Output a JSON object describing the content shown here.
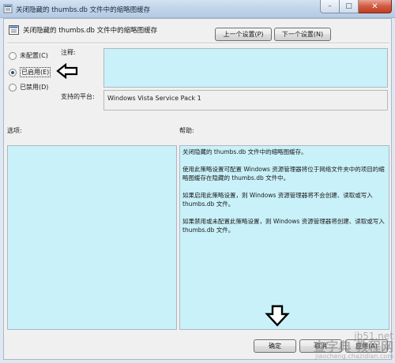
{
  "window": {
    "title": "关闭隐藏的 thumbs.db 文件中的缩略图缓存",
    "minimize_glyph": "–",
    "maximize_glyph": "□",
    "close_glyph": "✕"
  },
  "header": {
    "title": "关闭隐藏的 thumbs.db 文件中的缩略图缓存",
    "prev_button": "上一个设置(P)",
    "next_button": "下一个设置(N)"
  },
  "state": {
    "options": [
      {
        "label": "未配置(C)",
        "checked": false
      },
      {
        "label": "已启用(E)",
        "checked": true
      },
      {
        "label": "已禁用(D)",
        "checked": false
      }
    ]
  },
  "comment": {
    "label": "注释:",
    "value": ""
  },
  "platform": {
    "label": "支持的平台:",
    "value": "Windows Vista Service Pack 1"
  },
  "options_pane": {
    "label": "选项:"
  },
  "help_pane": {
    "label": "帮助:",
    "paragraphs": [
      "关闭隐藏的 thumbs.db 文件中的缩略图缓存。",
      "使用此策略设置可配置 Windows 资源管理器将位于网络文件夹中的项目的缩略图缓存在隐藏的 thumbs.db 文件中。",
      "如果启用此策略设置，则 Windows 资源管理器将不会创建、读取或写入 thumbs.db 文件。",
      "如果禁用或未配置此策略设置，则 Windows 资源管理器将创建、读取或写入 thumbs.db 文件。"
    ]
  },
  "footer": {
    "ok_button": "确定",
    "cancel_button": "取消",
    "apply_button": "应用(A)"
  },
  "watermark": {
    "site": "jb51.net",
    "mid": "查字典 教程网",
    "url": "jiaocheng.chazidian.com"
  },
  "colors": {
    "pane_background": "#c9f1f9",
    "dialog_background": "#f0f0f0"
  }
}
